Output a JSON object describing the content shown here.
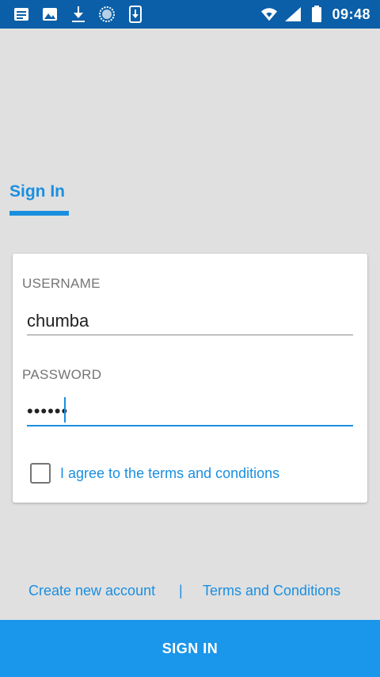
{
  "status_bar": {
    "time": "09:48",
    "left_icons": [
      "message-icon",
      "image-icon",
      "download-icon",
      "sync-icon",
      "download-arrow-icon"
    ],
    "right_icons": [
      "wifi-icon",
      "signal-icon",
      "battery-icon"
    ]
  },
  "tab": {
    "label": "Sign In"
  },
  "form": {
    "username_label": "USERNAME",
    "username_value": "chumba",
    "password_label": "PASSWORD",
    "password_value": "••••••",
    "agree_label": "I agree to the terms and conditions",
    "agree_checked": false
  },
  "links": {
    "create_account": "Create new account",
    "separator": "|",
    "terms": "Terms and Conditions"
  },
  "button": {
    "signin_label": "SIGN IN"
  },
  "colors": {
    "accent": "#1a8fe0",
    "status_bar": "#0a5fa8",
    "background": "#e0e0e0"
  }
}
